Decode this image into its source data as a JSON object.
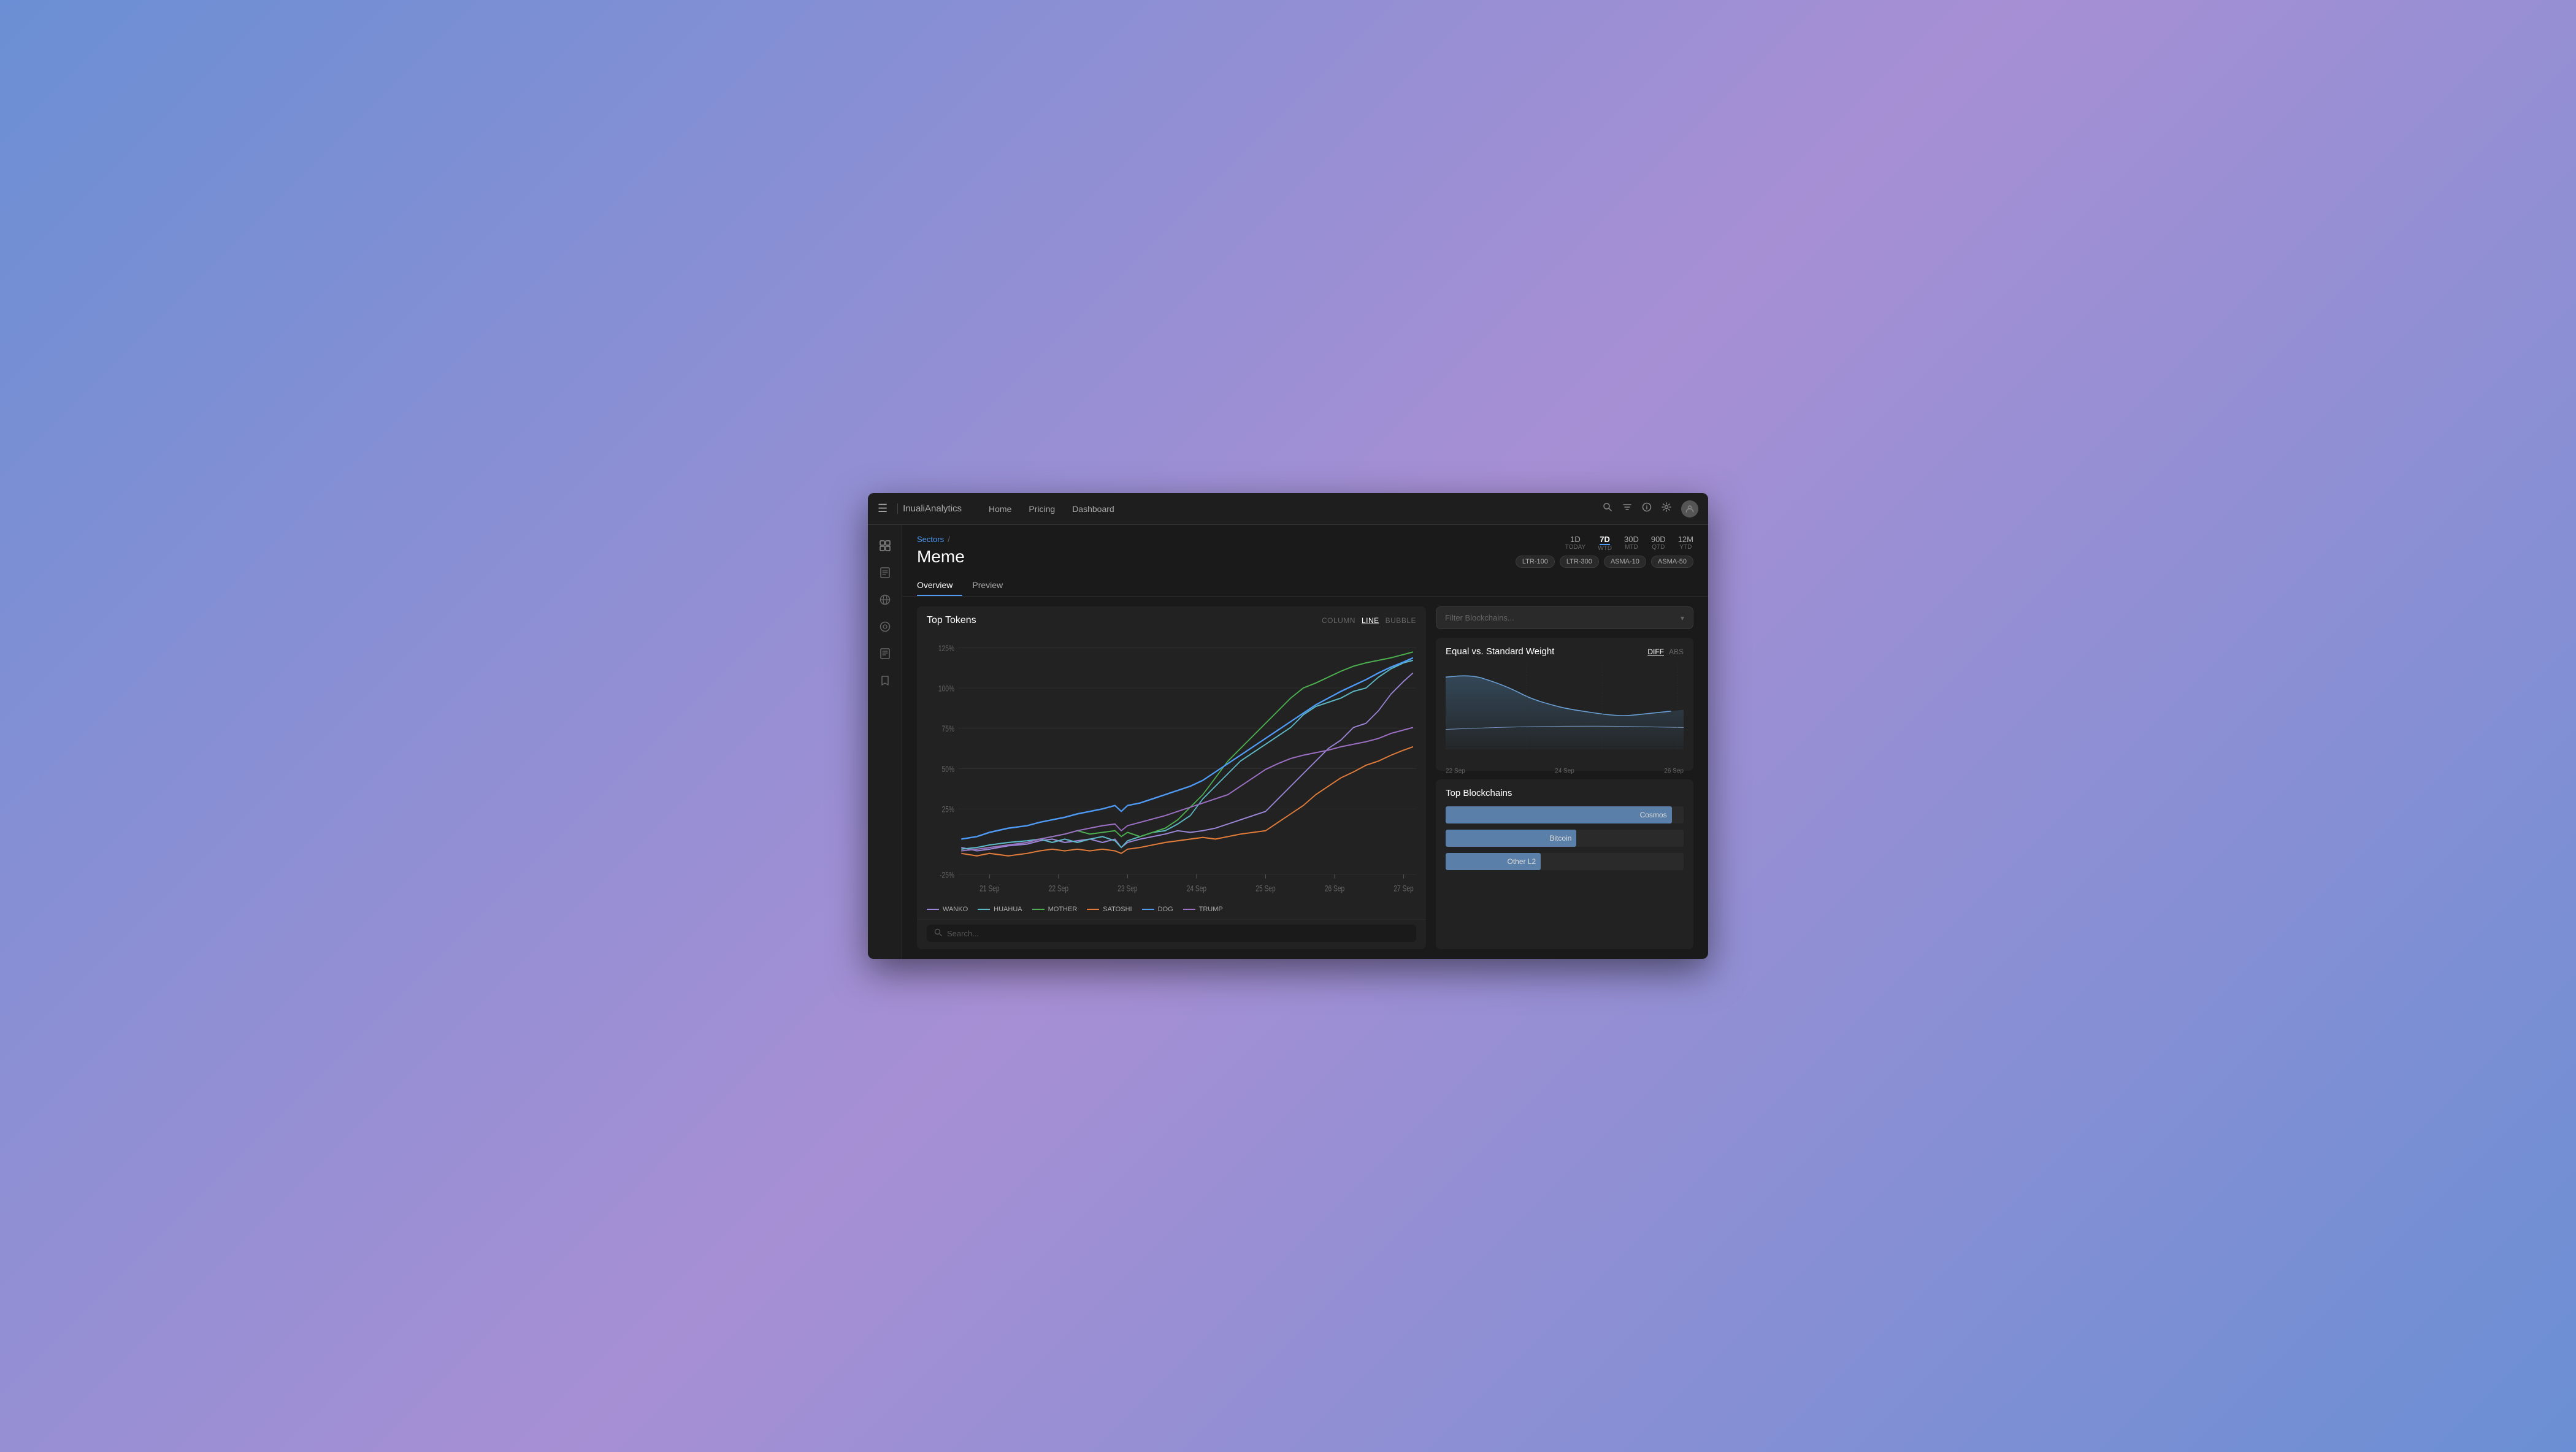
{
  "app": {
    "brand": "Inuali",
    "brand_suffix": "Analytics",
    "hamburger": "☰"
  },
  "topnav": {
    "links": [
      "Home",
      "Pricing",
      "Dashboard"
    ],
    "icons": {
      "search": "🔍",
      "filter": "⚗",
      "info": "ℹ",
      "settings": "✦",
      "user": "👤"
    }
  },
  "sidebar": {
    "items": [
      {
        "icon": "⊞",
        "name": "dashboard-icon"
      },
      {
        "icon": "📋",
        "name": "reports-icon"
      },
      {
        "icon": "🌐",
        "name": "globe-icon"
      },
      {
        "icon": "◎",
        "name": "analytics-icon"
      },
      {
        "icon": "📄",
        "name": "document-icon"
      },
      {
        "icon": "🔖",
        "name": "bookmark-icon"
      }
    ]
  },
  "breadcrumb": {
    "parent": "Sectors",
    "separator": "/",
    "current": ""
  },
  "page": {
    "title": "Meme"
  },
  "time_controls": {
    "buttons": [
      {
        "main": "1D",
        "sub": "TODAY"
      },
      {
        "main": "7D",
        "sub": "WTD",
        "active": true
      },
      {
        "main": "30D",
        "sub": "MTD"
      },
      {
        "main": "90D",
        "sub": "QTD"
      },
      {
        "main": "12M",
        "sub": "YTD"
      }
    ],
    "filters": [
      "LTR-100",
      "LTR-300",
      "ASMA-10",
      "ASMA-50"
    ]
  },
  "tabs": [
    "Overview",
    "Preview"
  ],
  "active_tab": "Overview",
  "chart": {
    "title": "Top Tokens",
    "type_buttons": [
      "COLUMN",
      "LINE",
      "BUBBLE"
    ],
    "active_type": "LINE",
    "y_labels": [
      "125%",
      "100%",
      "75%",
      "50%",
      "25%",
      "-25%"
    ],
    "x_labels": [
      "21 Sep",
      "22 Sep",
      "23 Sep",
      "24 Sep",
      "25 Sep",
      "26 Sep",
      "27 Sep"
    ],
    "legend": [
      {
        "name": "WANKO",
        "color": "#9b85d6"
      },
      {
        "name": "HUAHUA",
        "color": "#5cb8c4"
      },
      {
        "name": "MOTHER",
        "color": "#4caf50"
      },
      {
        "name": "SATOSHI",
        "color": "#e07b3a"
      },
      {
        "name": "DOG",
        "color": "#4e9af5"
      },
      {
        "name": "TRUMP",
        "color": "#9b6fc4"
      }
    ]
  },
  "search": {
    "placeholder": "Search..."
  },
  "right_panel": {
    "filter_placeholder": "Filter Blockchains...",
    "equal_weight": {
      "title": "Equal vs. Standard Weight",
      "buttons": [
        "DIFF",
        "ABS"
      ],
      "active_btn": "DIFF",
      "x_labels": [
        "22 Sep",
        "24 Sep",
        "26 Sep"
      ]
    },
    "top_blockchains": {
      "title": "Top Blockchains",
      "bars": [
        {
          "name": "Cosmos",
          "pct": 95
        },
        {
          "name": "Bitcoin",
          "pct": 55
        },
        {
          "name": "Other L2",
          "pct": 40
        }
      ]
    }
  }
}
